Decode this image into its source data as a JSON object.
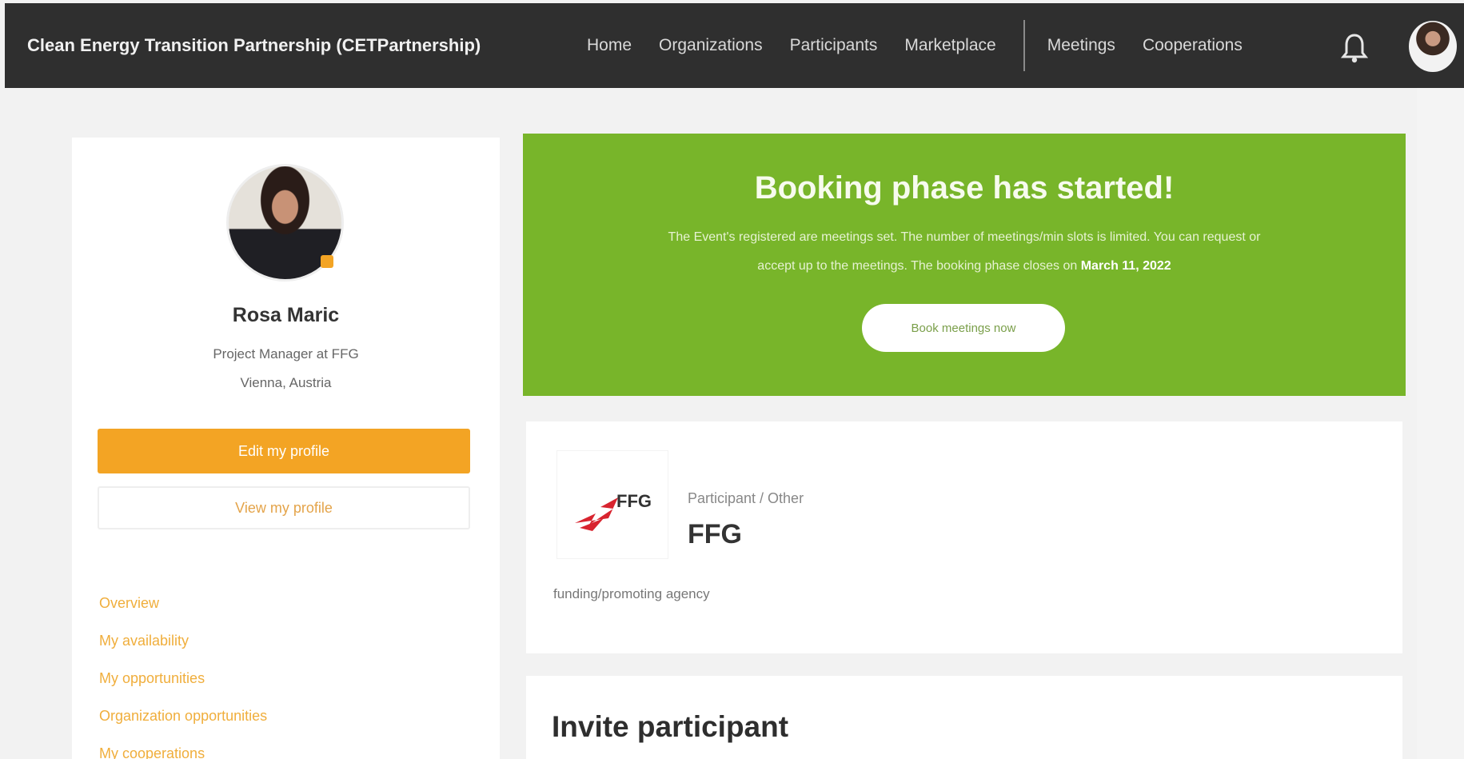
{
  "topbar": {
    "brand": "Clean Energy Transition Partnership (CETPartnership)",
    "nav": [
      "Home",
      "Organizations",
      "Participants",
      "Marketplace"
    ],
    "nav_right": [
      "Meetings",
      "Cooperations"
    ],
    "bell_icon": "bell-icon",
    "avatar_icon": "user-avatar"
  },
  "profile": {
    "name": "Rosa Maric",
    "role": "Project Manager at FFG",
    "location": "Vienna, Austria",
    "edit_button": "Edit my profile",
    "view_button": "View my profile",
    "menu": [
      "Overview",
      "My availability",
      "My opportunities",
      "Organization opportunities",
      "My cooperations"
    ]
  },
  "banner": {
    "title": "Booking phase has started!",
    "text_line1": "The Event's registered are meetings set. The number of meetings/min slots is limited. You can request or",
    "text_line2_prefix": "accept up to the meetings. The booking phase closes on",
    "close_date": "March 11, 2022",
    "button": "Book meetings now"
  },
  "organization": {
    "type": "Participant / Other",
    "name": "FFG",
    "description": "funding/promoting agency",
    "logo_text": "FFG"
  },
  "invite": {
    "title": "Invite participant"
  },
  "colors": {
    "topbar": "#2f2f2f",
    "accent_orange": "#f3a424",
    "banner_green": "#78b52a",
    "background": "#f2f2f2"
  }
}
